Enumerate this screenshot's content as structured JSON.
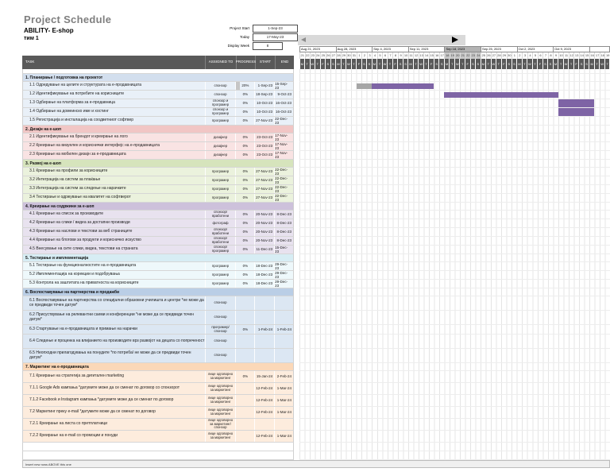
{
  "header": {
    "title": "Project Schedule",
    "subtitle": "ABILITY- E-shop",
    "team": "тим 1",
    "meta": [
      {
        "label": "Project Start",
        "value": "1-Sep-23"
      },
      {
        "label": "Today",
        "value": "17-May-23"
      },
      {
        "label": "Display Week",
        "value": "8"
      }
    ]
  },
  "table": {
    "columns": [
      "TASK",
      "ASSIGNED TO",
      "PROGRESS",
      "START",
      "END"
    ]
  },
  "timeline": {
    "weeks": [
      {
        "label": "Aug 21, 2023",
        "span": 7
      },
      {
        "label": "Aug 28, 2023",
        "span": 7
      },
      {
        "label": "Sep 4, 2023",
        "span": 7
      },
      {
        "label": "Sep 11, 2023",
        "span": 7
      },
      {
        "label": "Sep 18, 2023",
        "span": 7
      },
      {
        "label": "Sep 25, 2023",
        "span": 7
      },
      {
        "label": "Oct 2, 2023",
        "span": 7
      },
      {
        "label": "Oct 9, 2023",
        "span": 7
      },
      {
        "label": "",
        "span": 4
      }
    ],
    "highlight_index": 4,
    "day_numbers": [
      21,
      22,
      23,
      24,
      25,
      26,
      27,
      28,
      29,
      30,
      31,
      1,
      2,
      3,
      4,
      5,
      6,
      7,
      8,
      9,
      10,
      11,
      12,
      13,
      14,
      15,
      16,
      17,
      18,
      19,
      20,
      21,
      22,
      23,
      24,
      25,
      26,
      27,
      28,
      29,
      30,
      1,
      2,
      3,
      4,
      5,
      6,
      7,
      8,
      9,
      10,
      11,
      12,
      13,
      14,
      15,
      16,
      17,
      18,
      19
    ],
    "dow": "MTWTFSSMTWTFSSMTWTFSSMTWTFSSMTWTFSSMTWTFSSMTWTFSSMTWTFSSMTWT"
  },
  "colors": {
    "bar_fill": "#7e64a5",
    "bar_done": "#a6a6a6",
    "databar": "#c6c6c6",
    "header_dark": "#595959",
    "week_highlight": "#b3b3b3"
  },
  "sections": [
    {
      "title": "1. Планирање / подготовка на проектот",
      "colors": {
        "header": "#d3dfee",
        "row": "#e9f0f8"
      },
      "rows": [
        {
          "id": "1.1",
          "task": "Одредување на целите и структурата на е-продавницата",
          "assigned": "спонзор",
          "progress": "20%",
          "start": "1-Sep-23",
          "end": "15-Sep-23",
          "pbar": 20,
          "bar": {
            "start": 11,
            "len": 15,
            "done": 3
          }
        },
        {
          "id": "1.2",
          "task": "Идентификување на потребите на корисниците",
          "assigned": "спонзор",
          "progress": "0%",
          "start": "18-Sep-23",
          "end": "9-Oct-23",
          "bar": {
            "start": 28,
            "len": 22
          }
        },
        {
          "id": "1.3",
          "task": "Одбирање на платформа за е-продавница",
          "assigned": "спонзор и програмер",
          "progress": "0%",
          "start": "10-Oct-23",
          "end": "16-Oct-23",
          "bar": {
            "start": 50,
            "len": 7,
            "flush": true
          }
        },
        {
          "id": "1.4",
          "task": "Одбирање на домеинско име и хостинг",
          "assigned": "спонзор и програмер",
          "progress": "0%",
          "start": "10-Oct-23",
          "end": "16-Oct-23",
          "bar": {
            "start": 50,
            "len": 7,
            "flush": true
          }
        },
        {
          "id": "1.5",
          "task": "Регистрација и инсталација на соодветниот софтвер",
          "assigned": "програмер",
          "progress": "0%",
          "start": "27-Nov-23",
          "end": "22-Dec-23"
        }
      ]
    },
    {
      "title": "2. Дизајн на е-шоп",
      "colors": {
        "header": "#f1c6c5",
        "row": "#f9e3e3"
      },
      "rows": [
        {
          "id": "2.1",
          "task": "Идентификување на брендот и креирање на лого",
          "assigned": "дизајнер",
          "progress": "0%",
          "start": "23-Oct-23",
          "end": "17-Nov-23"
        },
        {
          "id": "2.2",
          "task": "Креирање на визуелен и кориснички интерфејс на е-продавницата",
          "assigned": "дизајнер",
          "progress": "0%",
          "start": "23-Oct-23",
          "end": "17-Nov-23"
        },
        {
          "id": "2.3",
          "task": "Креирање на мобилен дизајн за е-продавницата",
          "assigned": "дизајнер",
          "progress": "0%",
          "start": "23-Oct-23",
          "end": "17-Nov-23"
        }
      ]
    },
    {
      "title": "3. Развој на е-шоп",
      "colors": {
        "header": "#d6e4bc",
        "row": "#ebf2dd"
      },
      "rows": [
        {
          "id": "3.1",
          "task": "Креирање на профили за корисниците",
          "assigned": "програмер",
          "progress": "0%",
          "start": "27-Nov-23",
          "end": "22-Dec-23"
        },
        {
          "id": "3.2",
          "task": "Интеграција на систем за плаќање",
          "assigned": "програмер",
          "progress": "0%",
          "start": "27-Nov-23",
          "end": "22-Dec-23"
        },
        {
          "id": "3.3",
          "task": "Интеграција на систем за следење на нарачките",
          "assigned": "програмер",
          "progress": "0%",
          "start": "27-Nov-23",
          "end": "22-Dec-23"
        },
        {
          "id": "3.4",
          "task": "Тестирање и одржување на квалитет на софтверот",
          "assigned": "програмер",
          "progress": "0%",
          "start": "27-Nov-23",
          "end": "22-Dec-23"
        }
      ]
    },
    {
      "title": "4. Креирање на содржини за е-шоп",
      "colors": {
        "header": "#cdc1db",
        "row": "#e8e2ef"
      },
      "rows": [
        {
          "id": "4.1",
          "task": "Креирање на список за производите",
          "assigned": "спонзор/ вработени",
          "progress": "0%",
          "start": "20-Nov-23",
          "end": "8-Dec-23"
        },
        {
          "id": "4.2",
          "task": "Креирање на слики / видеа за достапни производи",
          "assigned": "фотограф",
          "progress": "0%",
          "start": "20-Nov-23",
          "end": "8-Dec-23"
        },
        {
          "id": "4.3",
          "task": "Креирање на наслови и текстови за веб страниците",
          "assigned": "спонзор/ вработени",
          "progress": "0%",
          "start": "20-Nov-23",
          "end": "8-Dec-23"
        },
        {
          "id": "4.4",
          "task": "Креирање на блогови за продукти и корисничко искуство",
          "assigned": "спонзор/ вработени",
          "progress": "0%",
          "start": "20-Nov-23",
          "end": "8-Dec-23"
        },
        {
          "id": "4.5",
          "task": "Внесување на сите слики, видеа, текстови на страната",
          "assigned": "спонзор/ програмер",
          "progress": "0%",
          "start": "11-Dec-23",
          "end": "15-Dec-23"
        }
      ]
    },
    {
      "title": "5. Тестирање и имплементација",
      "colors": {
        "header": "#d7edf4",
        "row": "#eef8fb"
      },
      "rows": [
        {
          "id": "5.1",
          "task": "Тестирање на функционалностите на е-продавницата",
          "assigned": "програмер",
          "progress": "0%",
          "start": "18-Dec-23",
          "end": "29-Dec-23"
        },
        {
          "id": "5.2",
          "task": "Имплементација на корекции и подобрувања",
          "assigned": "програмер",
          "progress": "0%",
          "start": "18-Dec-23",
          "end": "29-Dec-23"
        },
        {
          "id": "5.3",
          "task": "Контрола на заштитата на приватноста на корисниците",
          "assigned": "програмер",
          "progress": "0%",
          "start": "18-Dec-23",
          "end": "29-Dec-23"
        }
      ]
    },
    {
      "title": "6. Воспоставување на партнерства и продажби",
      "colors": {
        "header": "#bacee6",
        "row": "#dce7f3"
      },
      "rows": [
        {
          "id": "6.1",
          "task": "Воспоставување на партнерства со специјални образовни училишта и центри *не може да се предвиди точен датум*",
          "assigned": "спонзор",
          "progress": "",
          "start": "",
          "end": "",
          "h": 18
        },
        {
          "id": "6.2",
          "task": "Присуствување на релевантни саеми и конференции *не може да се предвиди точен датум*",
          "assigned": "спонзор",
          "progress": "",
          "start": "",
          "end": "",
          "h": 18
        },
        {
          "id": "6.3",
          "task": "Стартување на е-продавницата и примање на нарачки",
          "assigned": "програмер/ спонзор",
          "progress": "0%",
          "start": "1-Feb-24",
          "end": "1-Feb-24",
          "h": 12
        },
        {
          "id": "6.4",
          "task": "Следење и проценка на влијанието на производите врз развојот на децата со попреченост",
          "assigned": "спонзор",
          "progress": "",
          "start": "",
          "end": "",
          "h": 18
        },
        {
          "id": "6.5",
          "task": "Неопходни прилагодувања на понудите *по потреба/ не може да се предвиди точен датум*",
          "assigned": "спонзор",
          "progress": "",
          "start": "",
          "end": "",
          "h": 18
        }
      ]
    },
    {
      "title": "7. Маркетинг на е-продавницата",
      "colors": {
        "header": "#fbd8b8",
        "row": "#fdecdd"
      },
      "rows": [
        {
          "id": "7.1",
          "task": "Креирање на стратегија за дигитален marketing",
          "assigned": "лице одговорно за маркетинг",
          "progress": "0%",
          "start": "15-Jan-24",
          "end": "2-Feb-24",
          "h": 15
        },
        {
          "id": "7.1.1",
          "task": "Google Ads кампања *датумите може да се сменат по договор со спонзорот",
          "assigned": "лице одговорно за маркетинг",
          "progress": "",
          "start": "12-Feb-24",
          "end": "1-Mar-24",
          "h": 15
        },
        {
          "id": "7.1.2",
          "task": "Facebook и Instagram кампања *датумите може да се сменат по договор",
          "assigned": "лице одговорно за маркетинг",
          "progress": "",
          "start": "12-Feb-24",
          "end": "1-Mar-24",
          "h": 15
        },
        {
          "id": "7.2",
          "task": "Маркетинг преку е-mail *датумите може да се сменат по договор",
          "assigned": "лице одговорно за маркетинг",
          "progress": "",
          "start": "12-Feb-24",
          "end": "1-Mar-24",
          "h": 15
        },
        {
          "id": "7.2.1",
          "task": "Креирање на листа со претплатници",
          "assigned": "лице одговорно за маркетинг/ спонзор",
          "progress": "",
          "start": "",
          "end": "",
          "h": 15
        },
        {
          "id": "7.2.2",
          "task": "Креирање на е-mail со промоции и понуди",
          "assigned": "лице одговорно за маркетинг",
          "progress": "",
          "start": "12-Feb-24",
          "end": "1-Mar-24",
          "h": 15
        }
      ]
    }
  ],
  "empty_rows": 2,
  "footer": {
    "note": "Insert new rows ABOVE this one"
  }
}
